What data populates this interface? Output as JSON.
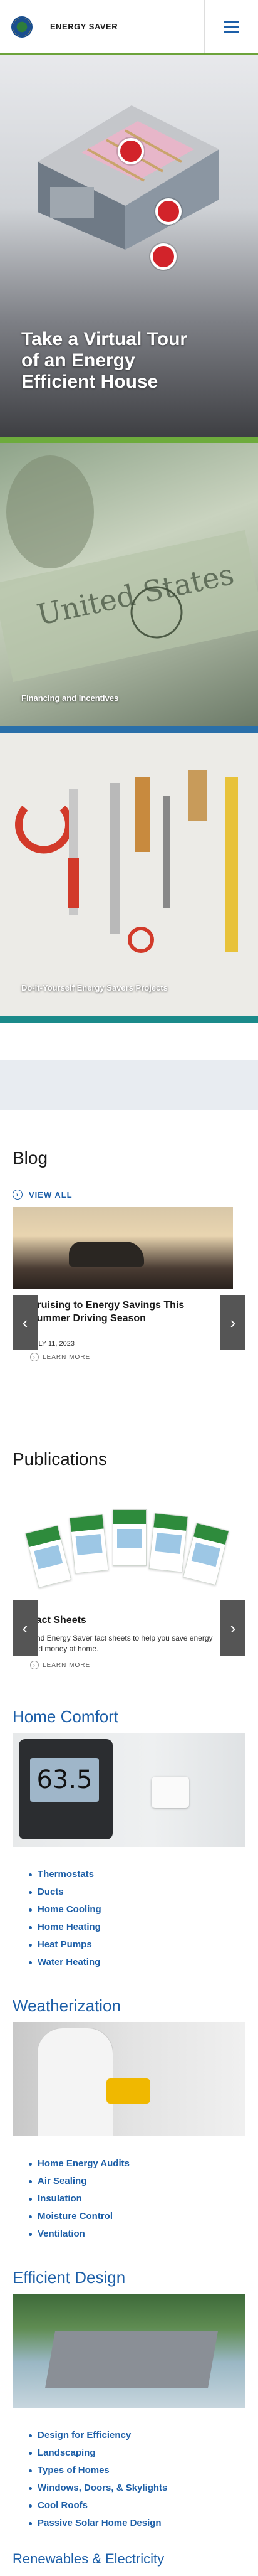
{
  "header": {
    "brand": "ENERGY SAVER"
  },
  "hero_cards": [
    {
      "title": "Take a Virtual Tour of an Energy Efficient House"
    },
    {
      "caption": "Financing and Incentives"
    },
    {
      "caption": "Do-It-Yourself Energy Savers Projects"
    }
  ],
  "blog": {
    "heading": "Blog",
    "view_all": "VIEW ALL",
    "post_title": "Cruising to Energy Savings This Summer Driving Season",
    "post_date": "JULY 11, 2023",
    "learn_more": "LEARN MORE"
  },
  "publications": {
    "heading": "Publications",
    "item_title": "Fact Sheets",
    "item_desc": "Find Energy Saver fact sheets to help you save energy and money at home.",
    "learn_more": "LEARN MORE"
  },
  "home_comfort": {
    "heading": "Home Comfort",
    "thermostat_reading": "63.5",
    "links": [
      "Thermostats",
      "Ducts",
      "Home Cooling",
      "Home Heating",
      "Heat Pumps",
      "Water Heating"
    ]
  },
  "weatherization": {
    "heading": "Weatherization",
    "links": [
      "Home Energy Audits",
      "Air Sealing",
      "Insulation",
      "Moisture Control",
      "Ventilation"
    ]
  },
  "efficient_design": {
    "heading": "Efficient Design",
    "links": [
      "Design for Efficiency",
      "Landscaping",
      "Types of Homes",
      "Windows, Doors, & Skylights",
      "Cool Roofs",
      "Passive Solar Home Design"
    ]
  },
  "next_heading": "Renewables & Electricity"
}
